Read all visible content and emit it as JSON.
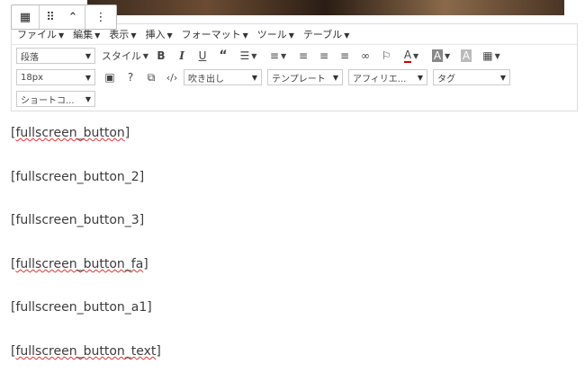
{
  "block_toolbar": {
    "items": [
      "▦",
      "⠿",
      "⌃",
      "⋮"
    ]
  },
  "menubar": [
    "ファイル",
    "編集",
    "表示",
    "挿入",
    "フォーマット",
    "ツール",
    "テーブル"
  ],
  "toolbar_row1": {
    "paragraph_select": "段落",
    "style_select": "スタイル",
    "icons": [
      "bold-icon",
      "italic-icon",
      "underline-icon",
      "blockquote-icon",
      "bullet-list-icon",
      "numbered-list-icon",
      "align-left-icon",
      "align-center-icon",
      "align-right-icon",
      "link-icon",
      "bookmark-icon",
      "text-color-icon",
      "background-color-icon",
      "highlight-icon",
      "table-icon"
    ]
  },
  "toolbar_row2": {
    "fontsize_select": "18px",
    "speech_select": "吹き出し",
    "template_select": "テンプレート",
    "affiliate_select": "アフィリエ...",
    "tag_select": "タグ"
  },
  "toolbar_row3": {
    "shortcode_select": "ショートコ..."
  },
  "content": {
    "paragraphs": [
      {
        "open": "[",
        "word": "fullscreen_button",
        "close": "]"
      },
      {
        "open": "[",
        "word": "fullscreen_button_2",
        "close": "]"
      },
      {
        "open": "[",
        "word": "fullscreen_button_3",
        "close": "]"
      },
      {
        "open": "[",
        "word": "fullscreen_button_fa",
        "close": "]"
      },
      {
        "open": "[",
        "word": "fullscreen_button_a1",
        "close": "]"
      },
      {
        "open": "[",
        "word": "fullscreen_button_text",
        "close": "]"
      }
    ]
  }
}
